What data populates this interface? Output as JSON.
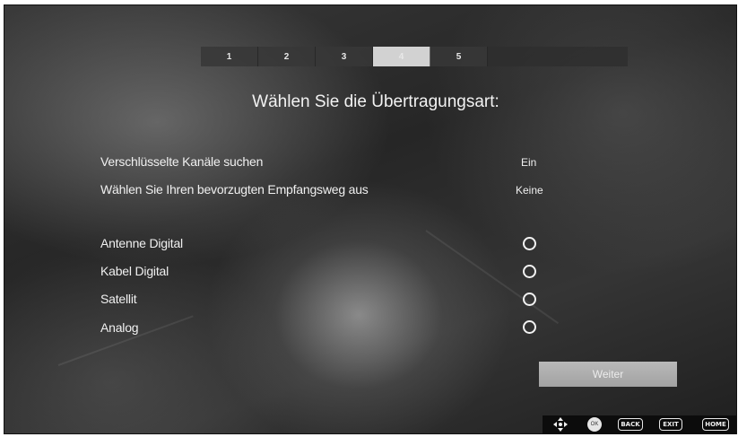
{
  "stepper": {
    "steps": [
      "1",
      "2",
      "3",
      "4",
      "5"
    ],
    "active_step": "4"
  },
  "title": "Wählen Sie die Übertragungsart:",
  "settings": {
    "encrypted": {
      "label": "Verschlüsselte Kanäle suchen",
      "value": "Ein"
    },
    "preferred": {
      "label": "Wählen Sie Ihren bevorzugten Empfangsweg aus",
      "value": "Keine"
    }
  },
  "options": [
    {
      "label": "Antenne Digital",
      "selected": false
    },
    {
      "label": "Kabel Digital",
      "selected": false
    },
    {
      "label": "Satellit",
      "selected": false
    },
    {
      "label": "Analog",
      "selected": false
    }
  ],
  "buttons": {
    "next": "Weiter"
  },
  "footer": {
    "icons": [
      "dpad-icon",
      "ok-icon"
    ],
    "ok_label": "OK",
    "back": "BACK",
    "exit": "EXIT",
    "home": "HOME"
  }
}
